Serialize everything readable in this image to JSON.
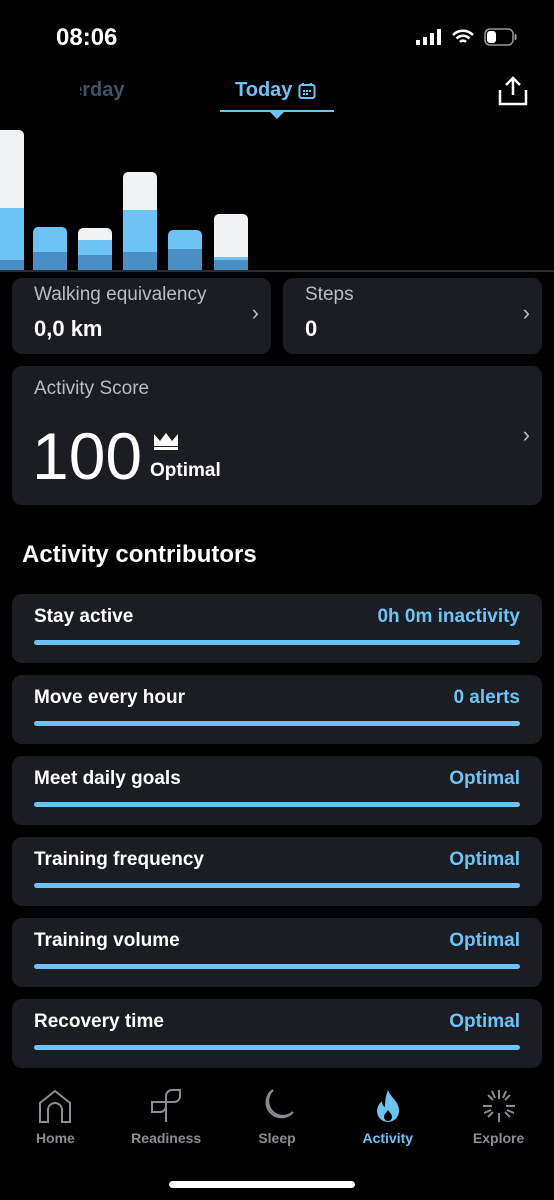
{
  "status_bar": {
    "time": "08:06"
  },
  "tabs": {
    "previous": "Yesterday",
    "current": "Today"
  },
  "chart_data": {
    "type": "bar",
    "stacked": true,
    "colors": {
      "high": "#f1f2f4",
      "medium": "#6cc3f5",
      "low": "#4a8fc4"
    },
    "series": [
      {
        "name": "low",
        "values": [
          10,
          18,
          15,
          18,
          21,
          10
        ]
      },
      {
        "name": "medium",
        "values": [
          52,
          25,
          15,
          42,
          19,
          3
        ]
      },
      {
        "name": "high",
        "values": [
          78,
          0,
          12,
          38,
          0,
          43
        ]
      }
    ]
  },
  "cards": {
    "walking": {
      "label": "Walking equivalency",
      "value": "0,0 km"
    },
    "steps": {
      "label": "Steps",
      "value": "0"
    }
  },
  "score": {
    "label": "Activity Score",
    "value": "100",
    "status": "Optimal",
    "icon": "crown-icon"
  },
  "contributors": {
    "title": "Activity contributors",
    "items": [
      {
        "name": "Stay active",
        "status": "0h 0m inactivity",
        "progress": 1
      },
      {
        "name": "Move every hour",
        "status": "0 alerts",
        "progress": 1
      },
      {
        "name": "Meet daily goals",
        "status": "Optimal",
        "progress": 1
      },
      {
        "name": "Training frequency",
        "status": "Optimal",
        "progress": 1
      },
      {
        "name": "Training volume",
        "status": "Optimal",
        "progress": 1
      },
      {
        "name": "Recovery time",
        "status": "Optimal",
        "progress": 1
      }
    ]
  },
  "nav": {
    "items": [
      {
        "label": "Home"
      },
      {
        "label": "Readiness"
      },
      {
        "label": "Sleep"
      },
      {
        "label": "Activity"
      },
      {
        "label": "Explore"
      }
    ]
  },
  "accent": "#6cc3f5"
}
